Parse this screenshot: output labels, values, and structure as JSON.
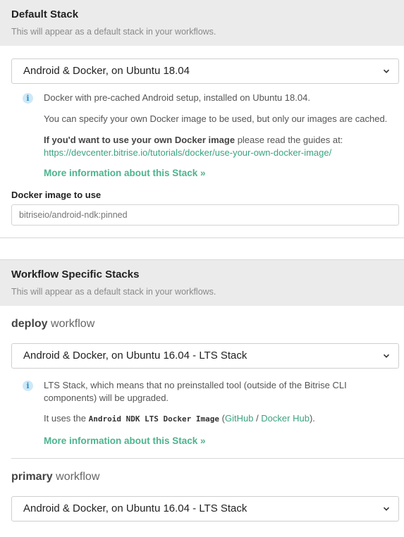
{
  "default_stack": {
    "title": "Default Stack",
    "subtitle": "This will appear as a default stack in your workflows.",
    "selected": "Android & Docker, on Ubuntu 18.04",
    "info": {
      "line1": "Docker with pre-cached Android setup, installed on Ubuntu 18.04.",
      "line2": "You can specify your own Docker image to be used, but only our images are cached.",
      "line3_bold": "If you'd want to use your own Docker image",
      "line3_rest": " please read the guides at:",
      "guide_link": "https://devcenter.bitrise.io/tutorials/docker/use-your-own-docker-image/",
      "more_link": "More information about this Stack »"
    },
    "docker_label": "Docker image to use",
    "docker_placeholder": "bitriseio/android-ndk:pinned"
  },
  "workflow_stacks": {
    "title": "Workflow Specific Stacks",
    "subtitle": "This will appear as a default stack in your workflows.",
    "workflow_suffix": " workflow",
    "deploy": {
      "name": "deploy",
      "selected": "Android & Docker, on Ubuntu 16.04 - LTS Stack",
      "info": {
        "lts_bold": "LTS",
        "lts_rest": " Stack, which means that no preinstalled tool (outside of the Bitrise CLI components) will be upgraded.",
        "uses_prefix": "It uses the ",
        "image_name": "Android NDK LTS Docker Image",
        "paren_open": " (",
        "github_link": "GitHub",
        "slash": " / ",
        "dockerhub_link": "Docker Hub",
        "paren_close": ").",
        "more_link": "More information about this Stack »"
      }
    },
    "primary": {
      "name": "primary",
      "selected": "Android & Docker, on Ubuntu 16.04 - LTS Stack"
    }
  }
}
